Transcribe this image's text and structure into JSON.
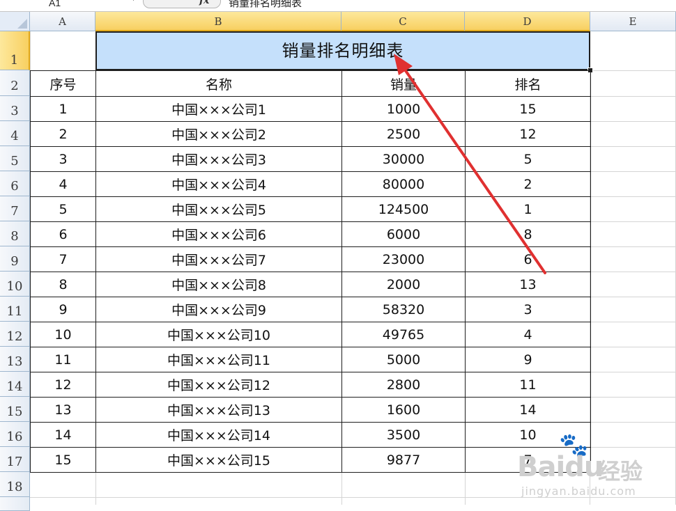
{
  "formula_bar": {
    "name_box": "A1",
    "fx_label": "fx",
    "content": "销量排名明细表"
  },
  "columns": [
    "A",
    "B",
    "C",
    "D",
    "E"
  ],
  "rows": [
    "1",
    "2",
    "3",
    "4",
    "5",
    "6",
    "7",
    "8",
    "9",
    "10",
    "11",
    "12",
    "13",
    "14",
    "15",
    "16",
    "17",
    "18"
  ],
  "sheet": {
    "title": "销量排名明细表",
    "headers": [
      "序号",
      "名称",
      "销量",
      "排名"
    ],
    "data": [
      [
        "1",
        "中国×××公司1",
        "1000",
        "15"
      ],
      [
        "2",
        "中国×××公司2",
        "2500",
        "12"
      ],
      [
        "3",
        "中国×××公司3",
        "30000",
        "5"
      ],
      [
        "4",
        "中国×××公司4",
        "80000",
        "2"
      ],
      [
        "5",
        "中国×××公司5",
        "124500",
        "1"
      ],
      [
        "6",
        "中国×××公司6",
        "6000",
        "8"
      ],
      [
        "7",
        "中国×××公司7",
        "23000",
        "6"
      ],
      [
        "8",
        "中国×××公司8",
        "2000",
        "13"
      ],
      [
        "9",
        "中国×××公司9",
        "58320",
        "3"
      ],
      [
        "10",
        "中国×××公司10",
        "49765",
        "4"
      ],
      [
        "11",
        "中国×××公司11",
        "5000",
        "9"
      ],
      [
        "12",
        "中国×××公司12",
        "2800",
        "11"
      ],
      [
        "13",
        "中国×××公司13",
        "1600",
        "14"
      ],
      [
        "14",
        "中国×××公司14",
        "3500",
        "10"
      ],
      [
        "15",
        "中国×××公司15",
        "9877",
        "7"
      ]
    ]
  },
  "watermark": {
    "brand": "Baidu",
    "brand_cn": "经验",
    "url": "jingyan.baidu.com"
  },
  "colors": {
    "title_fill": "#c5e0fb",
    "selected_header": "#f8d061",
    "annotation_arrow": "#e03030"
  }
}
